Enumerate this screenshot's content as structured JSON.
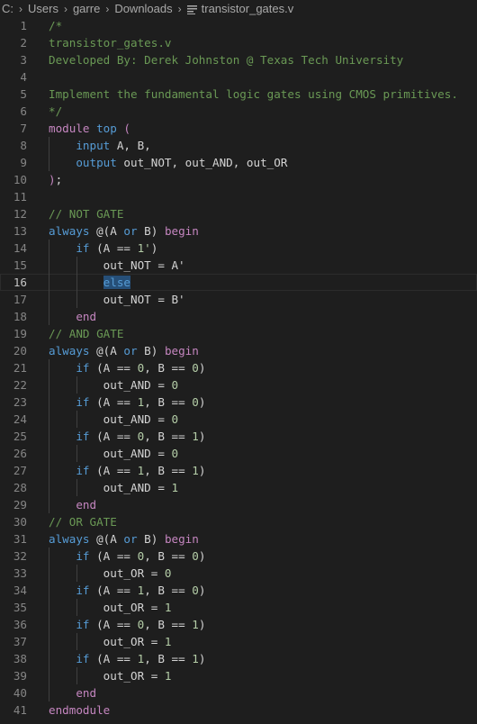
{
  "breadcrumb": {
    "items": [
      "C:",
      "Users",
      "garre",
      "Downloads"
    ],
    "file": "transistor_gates.v",
    "file_icon": "file-lines-icon"
  },
  "editor": {
    "current_line": 16,
    "colors": {
      "background": "#1e1e1e",
      "comment": "#6a9955",
      "keyword": "#569cd6",
      "control": "#c586c0",
      "number": "#b5cea8",
      "text": "#d4d4d4",
      "selection": "#264f78",
      "line_number": "#858585"
    },
    "lines": [
      {
        "n": "1",
        "indent": 0,
        "tokens": [
          {
            "t": "/*",
            "c": "comment"
          }
        ]
      },
      {
        "n": "2",
        "indent": 0,
        "tokens": [
          {
            "t": "transistor_gates.v",
            "c": "comment"
          }
        ]
      },
      {
        "n": "3",
        "indent": 0,
        "tokens": [
          {
            "t": "Developed By: Derek Johnston @ Texas Tech University",
            "c": "comment"
          }
        ]
      },
      {
        "n": "4",
        "indent": 0,
        "tokens": []
      },
      {
        "n": "5",
        "indent": 0,
        "tokens": [
          {
            "t": "Implement the fundamental logic gates using CMOS primitives.",
            "c": "comment"
          }
        ]
      },
      {
        "n": "6",
        "indent": 0,
        "tokens": [
          {
            "t": "*/",
            "c": "comment"
          }
        ]
      },
      {
        "n": "7",
        "indent": 0,
        "tokens": [
          {
            "t": "module",
            "c": "module"
          },
          {
            "t": " ",
            "c": "text"
          },
          {
            "t": "top",
            "c": "name"
          },
          {
            "t": " (",
            "c": "control"
          }
        ]
      },
      {
        "n": "8",
        "indent": 1,
        "tokens": [
          {
            "t": "    ",
            "c": "text"
          },
          {
            "t": "input",
            "c": "keyword"
          },
          {
            "t": " A, B,",
            "c": "text"
          }
        ]
      },
      {
        "n": "9",
        "indent": 1,
        "tokens": [
          {
            "t": "    ",
            "c": "text"
          },
          {
            "t": "output",
            "c": "keyword"
          },
          {
            "t": " out_NOT, out_AND, out_OR",
            "c": "text"
          }
        ]
      },
      {
        "n": "10",
        "indent": 0,
        "tokens": [
          {
            "t": ")",
            "c": "control"
          },
          {
            "t": ";",
            "c": "text"
          }
        ]
      },
      {
        "n": "11",
        "indent": 0,
        "tokens": []
      },
      {
        "n": "12",
        "indent": 0,
        "tokens": [
          {
            "t": "// NOT GATE",
            "c": "comment"
          }
        ]
      },
      {
        "n": "13",
        "indent": 0,
        "tokens": [
          {
            "t": "always",
            "c": "keyword"
          },
          {
            "t": " @(A ",
            "c": "text"
          },
          {
            "t": "or",
            "c": "keyword"
          },
          {
            "t": " B) ",
            "c": "text"
          },
          {
            "t": "begin",
            "c": "control"
          }
        ]
      },
      {
        "n": "14",
        "indent": 1,
        "tokens": [
          {
            "t": "    ",
            "c": "text"
          },
          {
            "t": "if",
            "c": "keyword"
          },
          {
            "t": " (A == ",
            "c": "text"
          },
          {
            "t": "1'",
            "c": "number"
          },
          {
            "t": ")",
            "c": "text"
          }
        ]
      },
      {
        "n": "15",
        "indent": 2,
        "tokens": [
          {
            "t": "        out_NOT = A'",
            "c": "text"
          }
        ]
      },
      {
        "n": "16",
        "indent": 2,
        "tokens": [
          {
            "t": "        ",
            "c": "text"
          },
          {
            "t": "else",
            "c": "keyword",
            "sel": true
          }
        ]
      },
      {
        "n": "17",
        "indent": 2,
        "tokens": [
          {
            "t": "        out_NOT = B'",
            "c": "text"
          }
        ]
      },
      {
        "n": "18",
        "indent": 1,
        "tokens": [
          {
            "t": "    ",
            "c": "text"
          },
          {
            "t": "end",
            "c": "control"
          }
        ]
      },
      {
        "n": "19",
        "indent": 0,
        "tokens": [
          {
            "t": "// AND GATE",
            "c": "comment"
          }
        ]
      },
      {
        "n": "20",
        "indent": 0,
        "tokens": [
          {
            "t": "always",
            "c": "keyword"
          },
          {
            "t": " @(A ",
            "c": "text"
          },
          {
            "t": "or",
            "c": "keyword"
          },
          {
            "t": " B) ",
            "c": "text"
          },
          {
            "t": "begin",
            "c": "control"
          }
        ]
      },
      {
        "n": "21",
        "indent": 1,
        "tokens": [
          {
            "t": "    ",
            "c": "text"
          },
          {
            "t": "if",
            "c": "keyword"
          },
          {
            "t": " (A == ",
            "c": "text"
          },
          {
            "t": "0",
            "c": "number"
          },
          {
            "t": ", B == ",
            "c": "text"
          },
          {
            "t": "0",
            "c": "number"
          },
          {
            "t": ")",
            "c": "text"
          }
        ]
      },
      {
        "n": "22",
        "indent": 2,
        "tokens": [
          {
            "t": "        out_AND = ",
            "c": "text"
          },
          {
            "t": "0",
            "c": "number"
          }
        ]
      },
      {
        "n": "23",
        "indent": 1,
        "tokens": [
          {
            "t": "    ",
            "c": "text"
          },
          {
            "t": "if",
            "c": "keyword"
          },
          {
            "t": " (A == ",
            "c": "text"
          },
          {
            "t": "1",
            "c": "number"
          },
          {
            "t": ", B == ",
            "c": "text"
          },
          {
            "t": "0",
            "c": "number"
          },
          {
            "t": ")",
            "c": "text"
          }
        ]
      },
      {
        "n": "24",
        "indent": 2,
        "tokens": [
          {
            "t": "        out_AND = ",
            "c": "text"
          },
          {
            "t": "0",
            "c": "number"
          }
        ]
      },
      {
        "n": "25",
        "indent": 1,
        "tokens": [
          {
            "t": "    ",
            "c": "text"
          },
          {
            "t": "if",
            "c": "keyword"
          },
          {
            "t": " (A == ",
            "c": "text"
          },
          {
            "t": "0",
            "c": "number"
          },
          {
            "t": ", B == ",
            "c": "text"
          },
          {
            "t": "1",
            "c": "number"
          },
          {
            "t": ")",
            "c": "text"
          }
        ]
      },
      {
        "n": "26",
        "indent": 2,
        "tokens": [
          {
            "t": "        out_AND = ",
            "c": "text"
          },
          {
            "t": "0",
            "c": "number"
          }
        ]
      },
      {
        "n": "27",
        "indent": 1,
        "tokens": [
          {
            "t": "    ",
            "c": "text"
          },
          {
            "t": "if",
            "c": "keyword"
          },
          {
            "t": " (A == ",
            "c": "text"
          },
          {
            "t": "1",
            "c": "number"
          },
          {
            "t": ", B == ",
            "c": "text"
          },
          {
            "t": "1",
            "c": "number"
          },
          {
            "t": ")",
            "c": "text"
          }
        ]
      },
      {
        "n": "28",
        "indent": 2,
        "tokens": [
          {
            "t": "        out_AND = ",
            "c": "text"
          },
          {
            "t": "1",
            "c": "number"
          }
        ]
      },
      {
        "n": "29",
        "indent": 1,
        "tokens": [
          {
            "t": "    ",
            "c": "text"
          },
          {
            "t": "end",
            "c": "control"
          }
        ]
      },
      {
        "n": "30",
        "indent": 0,
        "tokens": [
          {
            "t": "// OR GATE",
            "c": "comment"
          }
        ]
      },
      {
        "n": "31",
        "indent": 0,
        "tokens": [
          {
            "t": "always",
            "c": "keyword"
          },
          {
            "t": " @(A ",
            "c": "text"
          },
          {
            "t": "or",
            "c": "keyword"
          },
          {
            "t": " B) ",
            "c": "text"
          },
          {
            "t": "begin",
            "c": "control"
          }
        ]
      },
      {
        "n": "32",
        "indent": 1,
        "tokens": [
          {
            "t": "    ",
            "c": "text"
          },
          {
            "t": "if",
            "c": "keyword"
          },
          {
            "t": " (A == ",
            "c": "text"
          },
          {
            "t": "0",
            "c": "number"
          },
          {
            "t": ", B == ",
            "c": "text"
          },
          {
            "t": "0",
            "c": "number"
          },
          {
            "t": ")",
            "c": "text"
          }
        ]
      },
      {
        "n": "33",
        "indent": 2,
        "tokens": [
          {
            "t": "        out_OR = ",
            "c": "text"
          },
          {
            "t": "0",
            "c": "number"
          }
        ]
      },
      {
        "n": "34",
        "indent": 1,
        "tokens": [
          {
            "t": "    ",
            "c": "text"
          },
          {
            "t": "if",
            "c": "keyword"
          },
          {
            "t": " (A == ",
            "c": "text"
          },
          {
            "t": "1",
            "c": "number"
          },
          {
            "t": ", B == ",
            "c": "text"
          },
          {
            "t": "0",
            "c": "number"
          },
          {
            "t": ")",
            "c": "text"
          }
        ]
      },
      {
        "n": "35",
        "indent": 2,
        "tokens": [
          {
            "t": "        out_OR = ",
            "c": "text"
          },
          {
            "t": "1",
            "c": "number"
          }
        ]
      },
      {
        "n": "36",
        "indent": 1,
        "tokens": [
          {
            "t": "    ",
            "c": "text"
          },
          {
            "t": "if",
            "c": "keyword"
          },
          {
            "t": " (A == ",
            "c": "text"
          },
          {
            "t": "0",
            "c": "number"
          },
          {
            "t": ", B == ",
            "c": "text"
          },
          {
            "t": "1",
            "c": "number"
          },
          {
            "t": ")",
            "c": "text"
          }
        ]
      },
      {
        "n": "37",
        "indent": 2,
        "tokens": [
          {
            "t": "        out_OR = ",
            "c": "text"
          },
          {
            "t": "1",
            "c": "number"
          }
        ]
      },
      {
        "n": "38",
        "indent": 1,
        "tokens": [
          {
            "t": "    ",
            "c": "text"
          },
          {
            "t": "if",
            "c": "keyword"
          },
          {
            "t": " (A == ",
            "c": "text"
          },
          {
            "t": "1",
            "c": "number"
          },
          {
            "t": ", B == ",
            "c": "text"
          },
          {
            "t": "1",
            "c": "number"
          },
          {
            "t": ")",
            "c": "text"
          }
        ]
      },
      {
        "n": "39",
        "indent": 2,
        "tokens": [
          {
            "t": "        out_OR = ",
            "c": "text"
          },
          {
            "t": "1",
            "c": "number"
          }
        ]
      },
      {
        "n": "40",
        "indent": 1,
        "tokens": [
          {
            "t": "    ",
            "c": "text"
          },
          {
            "t": "end",
            "c": "control"
          }
        ]
      },
      {
        "n": "41",
        "indent": 0,
        "tokens": [
          {
            "t": "endmodule",
            "c": "module"
          }
        ]
      }
    ]
  }
}
